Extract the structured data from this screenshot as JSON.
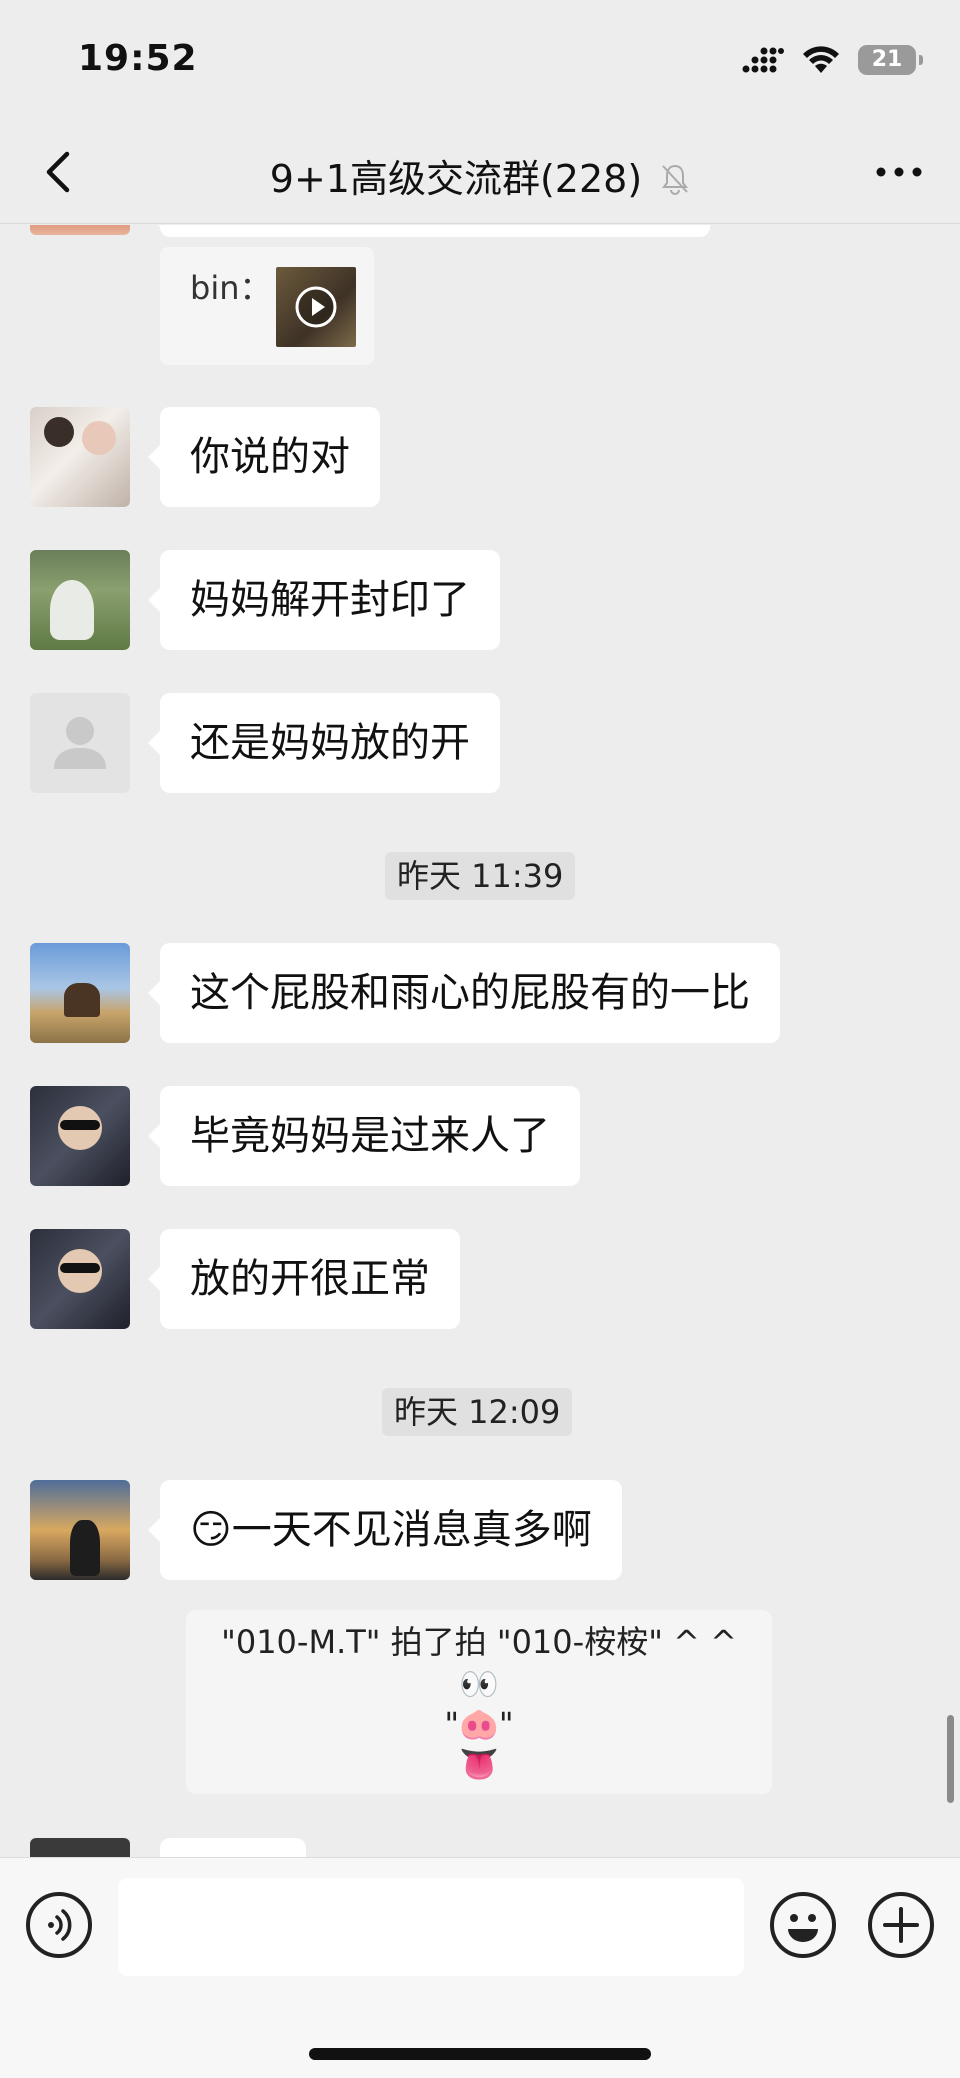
{
  "status_bar": {
    "time": "19:52",
    "battery": "21"
  },
  "header": {
    "title": "9+1高级交流群(228)"
  },
  "messages": {
    "quote_sender": "bin：",
    "msg1": "你说的对",
    "msg2": "妈妈解开封印了",
    "msg3": "还是妈妈放的开",
    "time1": "昨天 11:39",
    "msg4": "这个屁股和雨心的屁股有的一比",
    "msg5": "毕竟妈妈是过来人了",
    "msg6": "放的开很正常",
    "time2": "昨天 12:09",
    "msg7_emoji": "😏",
    "msg7": "一天不见消息真多啊",
    "pat_line1": "\"010-M.T\" 拍了拍 \"010-桉桉\" ^ ^",
    "pat_eyes": "👀",
    "pat_pig_left": "\"",
    "pat_pig": "🐽",
    "pat_pig_right": "\"",
    "pat_tongue": "👅"
  },
  "input": {
    "placeholder": ""
  },
  "colors": {
    "background": "#ededed",
    "bubble": "#ffffff",
    "input_bar": "#f7f7f7"
  }
}
